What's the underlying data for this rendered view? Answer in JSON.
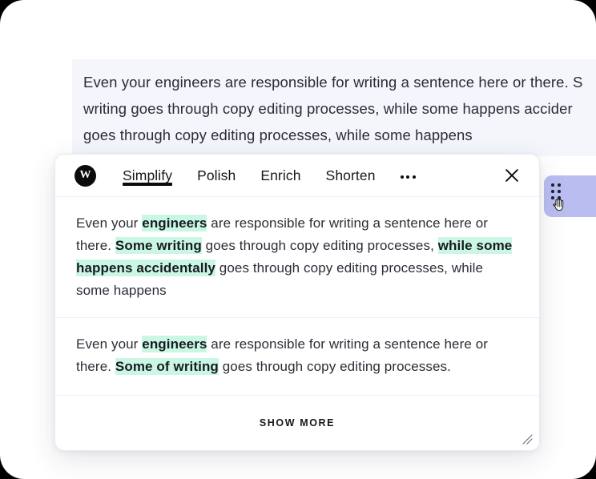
{
  "document": {
    "lines": [
      "Even your engineers are responsible for writing a sentence here or there. S",
      "writing goes through copy editing processes, while some happens accider",
      "goes through copy editing processes, while some happens"
    ]
  },
  "drag_widget": {
    "grip_icon": "drag-dots-icon",
    "cursor_icon": "grab-hand-cursor"
  },
  "card": {
    "logo": {
      "letter": "W",
      "icon": "wordtune-logo-icon"
    },
    "tabs": [
      {
        "label": "Simplify",
        "active": true
      },
      {
        "label": "Polish",
        "active": false
      },
      {
        "label": "Enrich",
        "active": false
      },
      {
        "label": "Shorten",
        "active": false
      }
    ],
    "more_icon": "ellipsis-icon",
    "close_icon": "close-icon",
    "suggestions": [
      {
        "segments": [
          {
            "text": "Even your ",
            "highlight": false
          },
          {
            "text": "engineers",
            "highlight": true
          },
          {
            "text": " are responsible for writing a sentence here or there. ",
            "highlight": false
          },
          {
            "text": "Some writing",
            "highlight": true
          },
          {
            "text": " goes through copy editing processes, ",
            "highlight": false
          },
          {
            "text": "while some happens accidentally",
            "highlight": true
          },
          {
            "text": " goes through copy editing processes, while some happens",
            "highlight": false
          }
        ]
      },
      {
        "segments": [
          {
            "text": "Even your ",
            "highlight": false
          },
          {
            "text": "engineers",
            "highlight": true
          },
          {
            "text": " are responsible for writing a sentence here or there. ",
            "highlight": false
          },
          {
            "text": "Some of writing",
            "highlight": true
          },
          {
            "text": " goes through copy editing processes.",
            "highlight": false
          }
        ]
      }
    ],
    "footer": {
      "show_more_label": "SHOW MORE",
      "resize_icon": "resize-handle-icon"
    }
  },
  "colors": {
    "highlight": "#c9f7e3",
    "doc_panel": "#f4f6fc",
    "widget": "#b9bdf0",
    "accent": "#0b0b0b"
  }
}
